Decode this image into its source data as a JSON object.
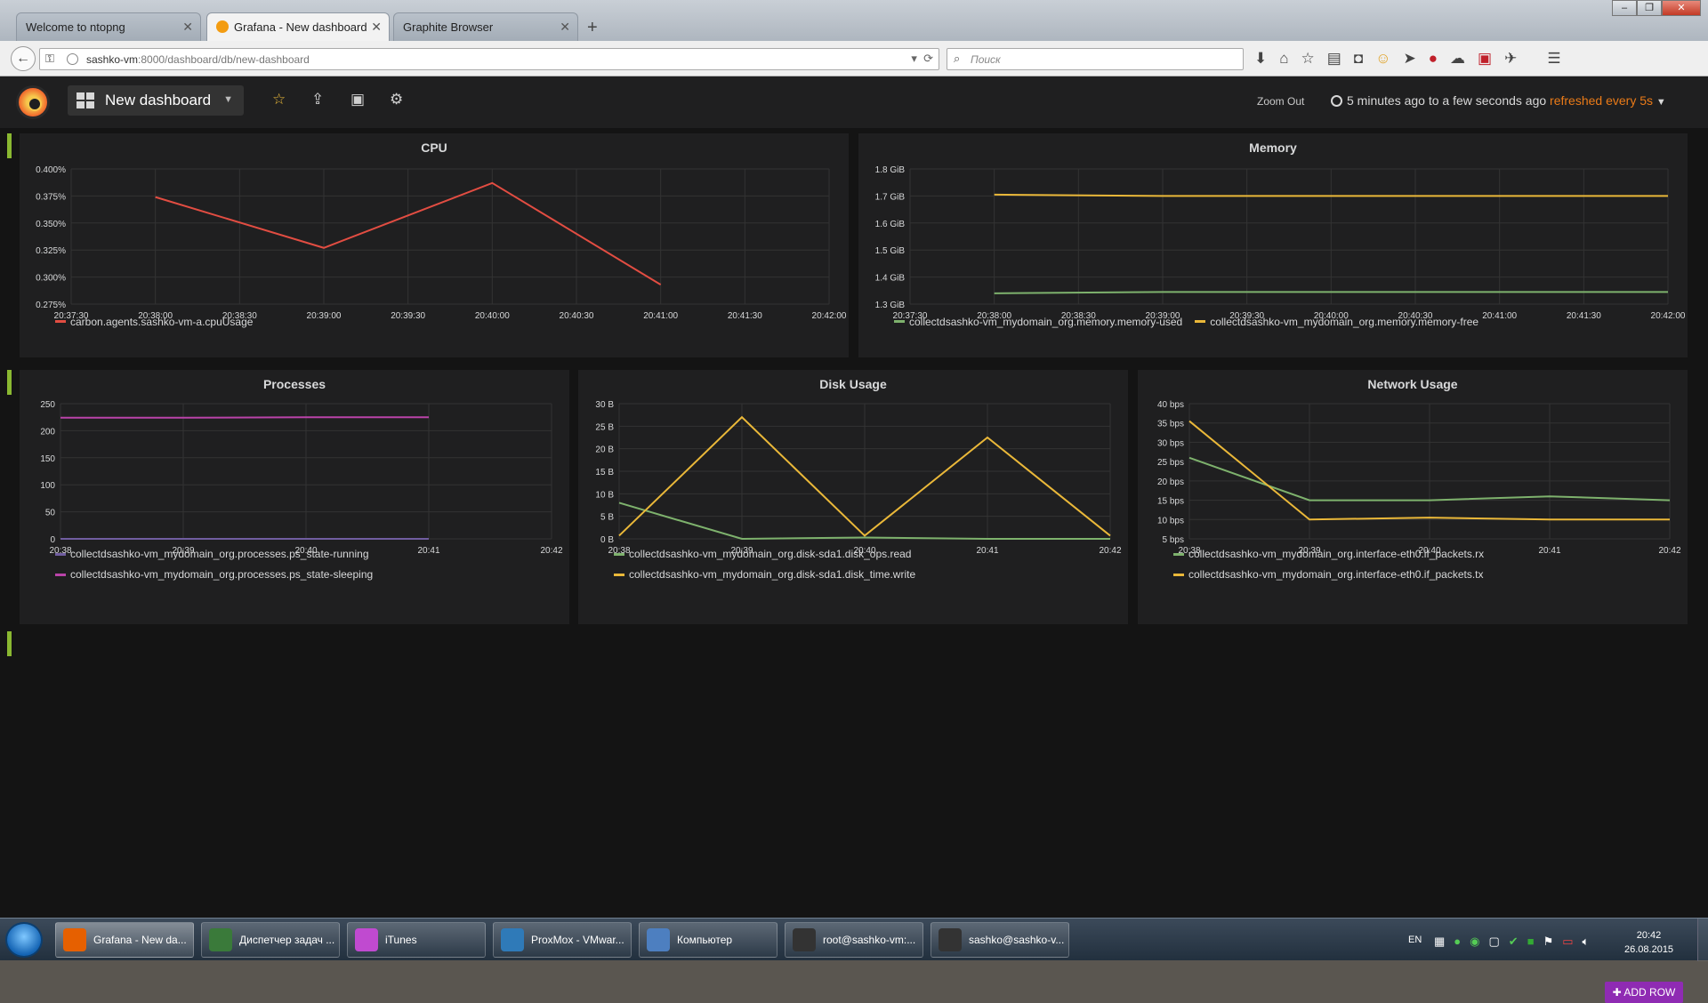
{
  "browser": {
    "tabs": [
      {
        "label": "Welcome to ntopng",
        "active": false
      },
      {
        "label": "Grafana - New dashboard",
        "active": true
      },
      {
        "label": "Graphite Browser",
        "active": false
      }
    ],
    "url_host": "sashko-vm",
    "url_rest": ":8000/dashboard/db/new-dashboard",
    "search_placeholder": "Поиск"
  },
  "grafana": {
    "dashboard_title": "New dashboard",
    "zoom_out": "Zoom Out",
    "time_range": "5 minutes ago to a few seconds ago",
    "refresh": "refreshed every 5s",
    "add_row": "ADD ROW"
  },
  "colors": {
    "green": "#7eb26d",
    "yellow": "#eab839",
    "red": "#e24d42",
    "purple": "#705da0",
    "magenta": "#ba43a9",
    "accent": "#eb7b18"
  },
  "panels": [
    {
      "title": "CPU",
      "chart_data": {
        "type": "line",
        "x_ticks": [
          "20:37:30",
          "20:38:00",
          "20:38:30",
          "20:39:00",
          "20:39:30",
          "20:40:00",
          "20:40:30",
          "20:41:00",
          "20:41:30",
          "20:42:00"
        ],
        "y_ticks": [
          "0.275%",
          "0.300%",
          "0.325%",
          "0.350%",
          "0.375%",
          "0.400%"
        ],
        "ylim": [
          0.275,
          0.4
        ],
        "xlim": [
          0,
          9
        ],
        "series": [
          {
            "name": "carbon.agents.sashko-vm-a.cpuUsage",
            "color": "#e24d42",
            "x": [
              1,
              3,
              5,
              7
            ],
            "y": [
              0.374,
              0.327,
              0.387,
              0.293
            ]
          }
        ]
      }
    },
    {
      "title": "Memory",
      "chart_data": {
        "type": "line",
        "x_ticks": [
          "20:37:30",
          "20:38:00",
          "20:38:30",
          "20:39:00",
          "20:39:30",
          "20:40:00",
          "20:40:30",
          "20:41:00",
          "20:41:30",
          "20:42:00"
        ],
        "y_ticks": [
          "1.3 GiB",
          "1.4 GiB",
          "1.5 GiB",
          "1.6 GiB",
          "1.7 GiB",
          "1.8 GiB"
        ],
        "ylim": [
          1.3,
          1.8
        ],
        "xlim": [
          0,
          9
        ],
        "series": [
          {
            "name": "collectdsashko-vm_mydomain_org.memory.memory-used",
            "color": "#7eb26d",
            "x": [
              1,
              3,
              5,
              7,
              9
            ],
            "y": [
              1.34,
              1.345,
              1.345,
              1.345,
              1.345
            ]
          },
          {
            "name": "collectdsashko-vm_mydomain_org.memory.memory-free",
            "color": "#eab839",
            "x": [
              1,
              3,
              5,
              7,
              9
            ],
            "y": [
              1.705,
              1.7,
              1.7,
              1.7,
              1.7
            ]
          }
        ]
      }
    },
    {
      "title": "Processes",
      "chart_data": {
        "type": "line",
        "x_ticks": [
          "20:38",
          "20:39",
          "20:40",
          "20:41",
          "20:42"
        ],
        "y_ticks": [
          "0",
          "50",
          "100",
          "150",
          "200",
          "250"
        ],
        "ylim": [
          0,
          250
        ],
        "xlim": [
          0,
          4
        ],
        "series": [
          {
            "name": "collectdsashko-vm_mydomain_org.processes.ps_state-running",
            "color": "#705da0",
            "x": [
              0,
              1,
              2,
              3
            ],
            "y": [
              0,
              0,
              0,
              0
            ]
          },
          {
            "name": "collectdsashko-vm_mydomain_org.processes.ps_state-sleeping",
            "color": "#ba43a9",
            "x": [
              0,
              1,
              2,
              3
            ],
            "y": [
              224,
              224,
              225,
              225
            ]
          }
        ]
      }
    },
    {
      "title": "Disk Usage",
      "chart_data": {
        "type": "line",
        "x_ticks": [
          "20:38",
          "20:39",
          "20:40",
          "20:41",
          "20:42"
        ],
        "y_ticks": [
          "0 B",
          "5 B",
          "10 B",
          "15 B",
          "20 B",
          "25 B",
          "30 B"
        ],
        "ylim": [
          0,
          30
        ],
        "xlim": [
          0,
          4
        ],
        "series": [
          {
            "name": "collectdsashko-vm_mydomain_org.disk-sda1.disk_ops.read",
            "color": "#7eb26d",
            "x": [
              0,
              1,
              2,
              3,
              4
            ],
            "y": [
              8,
              0,
              0.3,
              0,
              0
            ]
          },
          {
            "name": "collectdsashko-vm_mydomain_org.disk-sda1.disk_time.write",
            "color": "#eab839",
            "x": [
              0,
              1,
              2,
              3,
              4
            ],
            "y": [
              0.7,
              27,
              0.7,
              22.5,
              0.7
            ]
          }
        ]
      }
    },
    {
      "title": "Network Usage",
      "chart_data": {
        "type": "line",
        "x_ticks": [
          "20:38",
          "20:39",
          "20:40",
          "20:41",
          "20:42"
        ],
        "y_ticks": [
          "5 bps",
          "10 bps",
          "15 bps",
          "20 bps",
          "25 bps",
          "30 bps",
          "35 bps",
          "40 bps"
        ],
        "ylim": [
          5,
          40
        ],
        "xlim": [
          0,
          4
        ],
        "series": [
          {
            "name": "collectdsashko-vm_mydomain_org.interface-eth0.if_packets.rx",
            "color": "#7eb26d",
            "x": [
              0,
              1,
              2,
              3,
              4
            ],
            "y": [
              26,
              15,
              15,
              16,
              15
            ]
          },
          {
            "name": "collectdsashko-vm_mydomain_org.interface-eth0.if_packets.tx",
            "color": "#eab839",
            "x": [
              0,
              1,
              2,
              3,
              4
            ],
            "y": [
              35.5,
              10,
              10.5,
              10,
              10
            ]
          }
        ]
      }
    }
  ],
  "taskbar": {
    "buttons": [
      {
        "label": "Grafana - New da...",
        "icon": "firefox-icon",
        "color": "#e66000"
      },
      {
        "label": "Диспетчер задач ...",
        "icon": "task-manager-icon",
        "color": "#3a7a3a"
      },
      {
        "label": "iTunes",
        "icon": "itunes-icon",
        "color": "#c04ad0"
      },
      {
        "label": "ProxMox - VMwar...",
        "icon": "vmware-icon",
        "color": "#2f7ab8"
      },
      {
        "label": "Компьютер",
        "icon": "computer-icon",
        "color": "#4d7fc0"
      },
      {
        "label": "root@sashko-vm:...",
        "icon": "terminal-icon",
        "color": "#333333"
      },
      {
        "label": "sashko@sashko-v...",
        "icon": "terminal-icon",
        "color": "#333333"
      }
    ],
    "lang": "EN",
    "time": "20:42",
    "date": "26.08.2015"
  }
}
